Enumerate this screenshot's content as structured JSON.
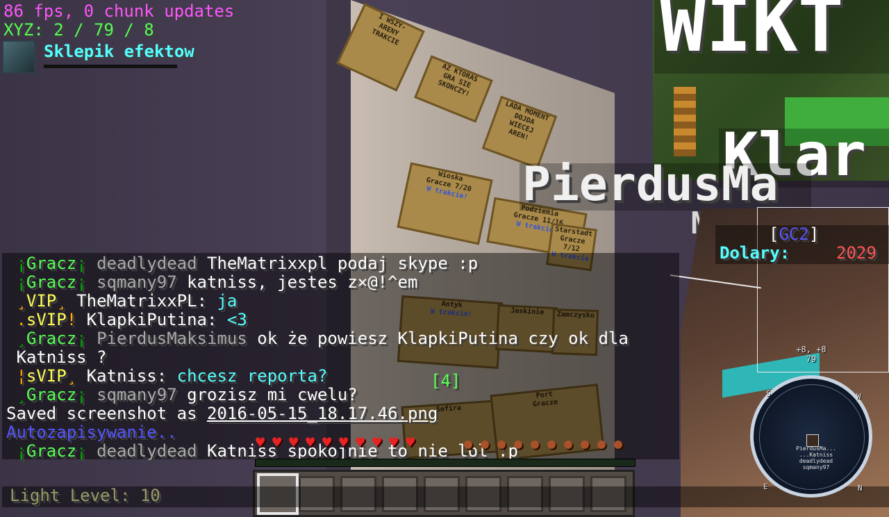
{
  "debug": {
    "fps_line": "86 fps, 0 chunk updates",
    "xyz_line": "XYZ: 2 / 79 / 8"
  },
  "shop": {
    "icon": "beacon-icon",
    "title": "Sklepik efektow"
  },
  "world": {
    "big_text_top": "WIKT",
    "big_text_right": "Klar",
    "nameplate": "PierdusMa",
    "nameplate_sub": "Mer",
    "signs": [
      {
        "lines": [
          "I WSZY-",
          "ARENY",
          "TRAKCIE"
        ]
      },
      {
        "lines": [
          "AZ KTORAS",
          "GRA SIE",
          "SKONCZY!"
        ]
      },
      {
        "lines": [
          "LADA MOMENT",
          "DOJDA",
          "WIECEJ",
          "AREN!"
        ]
      },
      {
        "lines": [
          "Wioska",
          "Gracze 7/20",
          "W trakcie!"
        ]
      },
      {
        "lines": [
          "Podziemia",
          "Gracze 11/16",
          "W trakcie!"
        ]
      },
      {
        "lines": [
          "Starstadt",
          "Gracze 7/12",
          "W trakcie"
        ]
      },
      {
        "lines": [
          "Antyk",
          "",
          "W trakcie!"
        ]
      },
      {
        "lines": [
          "Jaskinie",
          "",
          ""
        ]
      },
      {
        "lines": [
          "Zamczysko",
          "",
          ""
        ]
      },
      {
        "lines": [
          "Sefira",
          "",
          ""
        ]
      },
      {
        "lines": [
          "Port",
          "Gracze",
          ""
        ]
      }
    ]
  },
  "chat": {
    "lines": [
      [
        {
          "t": " ",
          "c": "w"
        },
        {
          "t": "¡",
          "c": "dg"
        },
        {
          "t": "Gracz",
          "c": "g"
        },
        {
          "t": "¡ ",
          "c": "dg"
        },
        {
          "t": "deadlydead ",
          "c": "gray"
        },
        {
          "t": "TheMatrixxpl podaj skype :p",
          "c": "w"
        }
      ],
      [
        {
          "t": " ",
          "c": "w"
        },
        {
          "t": "¡",
          "c": "dg"
        },
        {
          "t": "Gracz",
          "c": "g"
        },
        {
          "t": "¡ ",
          "c": "dg"
        },
        {
          "t": "sqmany97 ",
          "c": "gray"
        },
        {
          "t": "katniss, jestes z×@!^em",
          "c": "w"
        }
      ],
      [
        {
          "t": " ",
          "c": "w"
        },
        {
          "t": "¸",
          "c": "o"
        },
        {
          "t": "VIP",
          "c": "y"
        },
        {
          "t": "¸ ",
          "c": "o"
        },
        {
          "t": "TheMatrixxPL: ",
          "c": "w"
        },
        {
          "t": "ja",
          "c": "aq"
        }
      ],
      [
        {
          "t": " ",
          "c": "w"
        },
        {
          "t": ".",
          "c": "o"
        },
        {
          "t": "sVIP",
          "c": "y"
        },
        {
          "t": "! ",
          "c": "o"
        },
        {
          "t": "KlapkiPutina: ",
          "c": "w"
        },
        {
          "t": "<3",
          "c": "aq"
        }
      ],
      [
        {
          "t": " ",
          "c": "w"
        },
        {
          "t": "¸",
          "c": "dg"
        },
        {
          "t": "Gracz",
          "c": "g"
        },
        {
          "t": "¡ ",
          "c": "dg"
        },
        {
          "t": "PierdusMaksimus ",
          "c": "gray"
        },
        {
          "t": "ok że powiesz KlapkiPutina czy ok dla",
          "c": "w"
        }
      ],
      [
        {
          "t": " Katniss ?",
          "c": "w"
        }
      ],
      [
        {
          "t": " ",
          "c": "w"
        },
        {
          "t": "¦",
          "c": "o"
        },
        {
          "t": "sVIP",
          "c": "y"
        },
        {
          "t": "¸ ",
          "c": "o"
        },
        {
          "t": "Katniss: ",
          "c": "w"
        },
        {
          "t": "chcesz reporta?",
          "c": "aq"
        }
      ],
      [
        {
          "t": " ",
          "c": "w"
        },
        {
          "t": "¸",
          "c": "dg"
        },
        {
          "t": "Gracz",
          "c": "g"
        },
        {
          "t": "¡ ",
          "c": "dg"
        },
        {
          "t": "sqmany97 ",
          "c": "gray"
        },
        {
          "t": "grozisz mi cwelu?",
          "c": "w"
        }
      ],
      [
        {
          "t": "Saved screenshot as ",
          "c": "w"
        },
        {
          "t": "2016-05-15_18.17.46.png",
          "c": "w u"
        }
      ],
      [
        {
          "t": "Autozapisywanie..",
          "c": "b"
        }
      ],
      [
        {
          "t": " ",
          "c": "w"
        },
        {
          "t": "¡",
          "c": "dg"
        },
        {
          "t": "Gracz",
          "c": "g"
        },
        {
          "t": "¡ ",
          "c": "dg"
        },
        {
          "t": "deadlydead ",
          "c": "gray"
        },
        {
          "t": "Katniss spokojnie to nie lol :p",
          "c": "w"
        }
      ]
    ]
  },
  "counter": "[4]",
  "scoreboard": {
    "title_open": "[",
    "title_name": "GC2",
    "title_close": "]",
    "label": "Dolary:",
    "value": "2029"
  },
  "hud": {
    "light_level": "Light Level: 10",
    "hearts": 10,
    "food": 10,
    "hotbar_slots": 9,
    "selected_slot": 1,
    "heart_icon": "heart-icon",
    "food_icon": "drumstick-icon"
  },
  "minimap": {
    "coords_line1": "+8, +8",
    "coords_line2": "79",
    "north": "S",
    "east": "W",
    "south": "N",
    "west": "E",
    "nearby": [
      "PierdusMa...",
      "...Katniss",
      "deadlydead",
      "sqmany97"
    ]
  },
  "colors": {
    "fps": "#ff55ff",
    "xyz": "#55ff55",
    "aqua": "#55ffff",
    "gold": "#ffaa00",
    "yellow": "#ffff55",
    "red": "#ff5555",
    "blue": "#5555ff"
  }
}
